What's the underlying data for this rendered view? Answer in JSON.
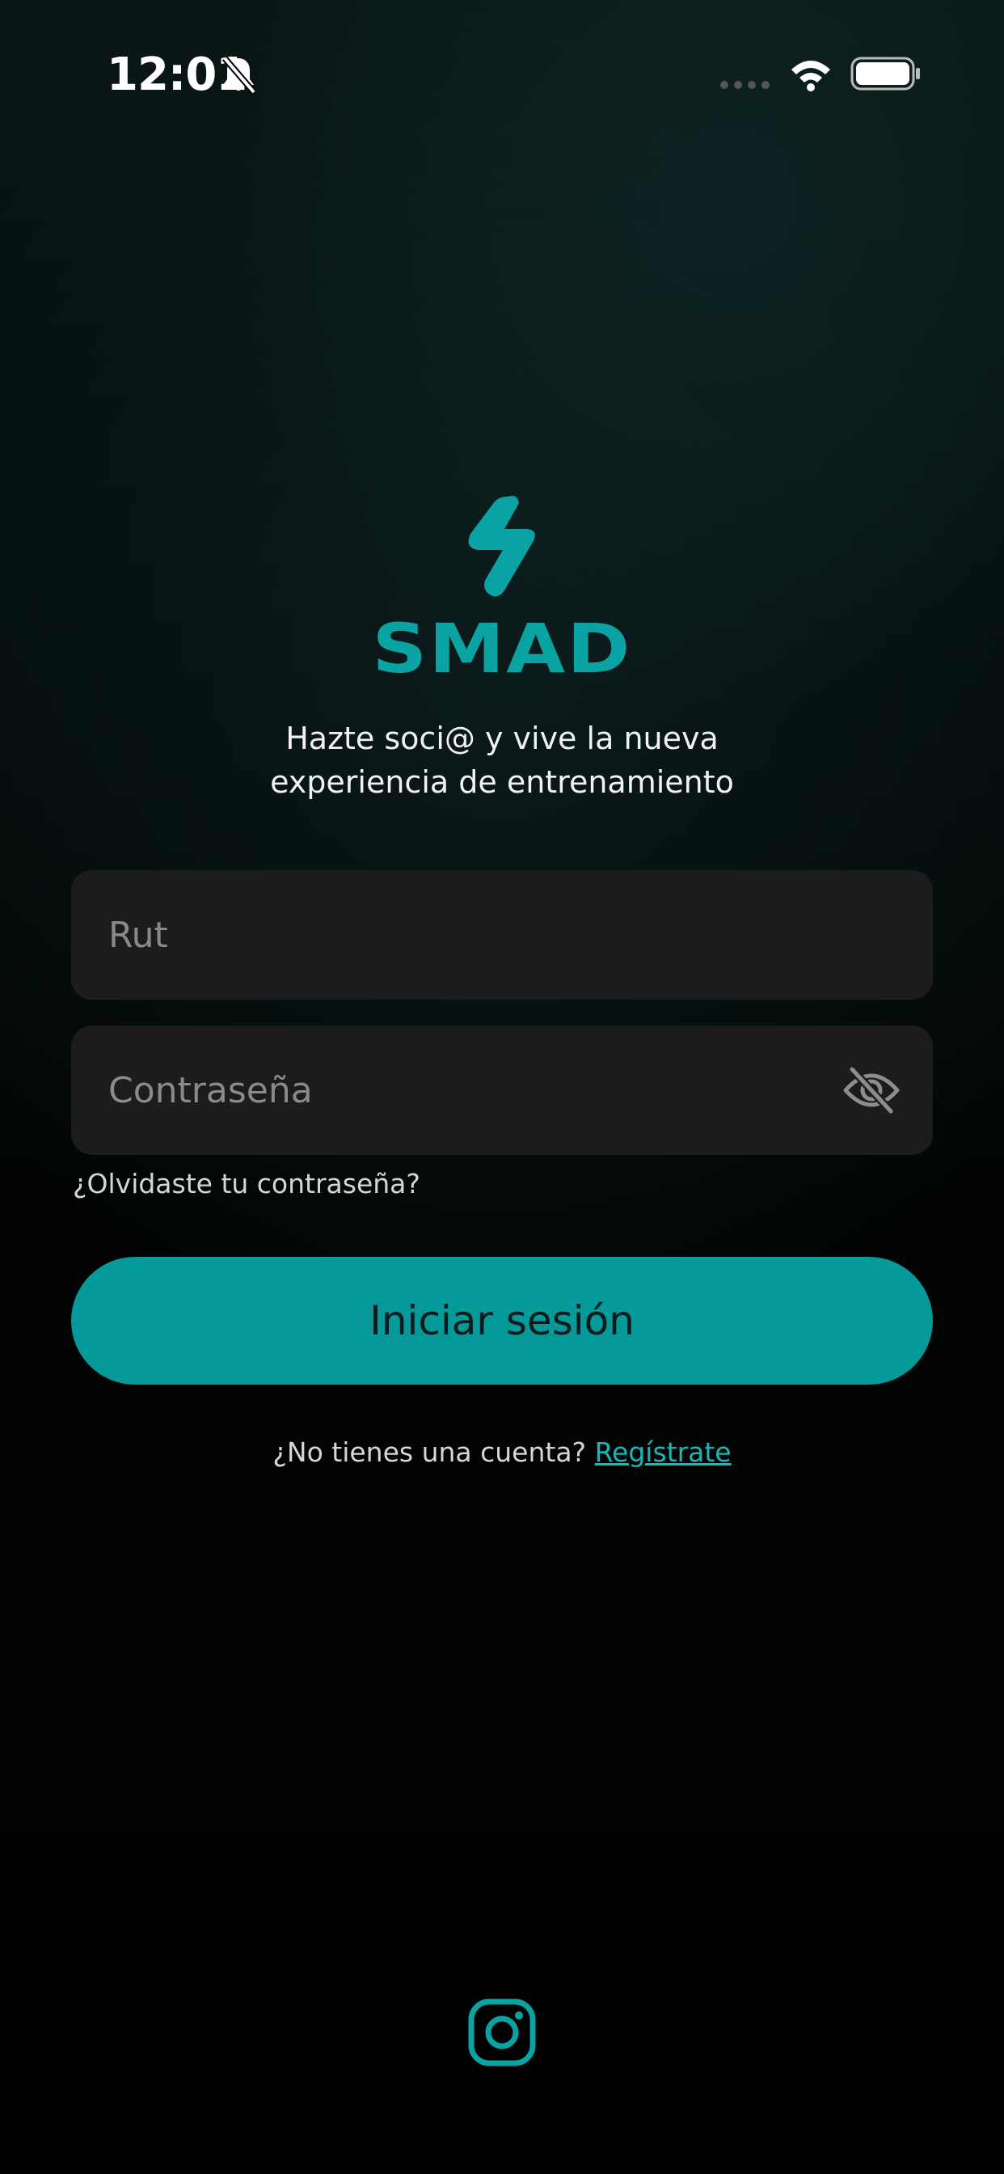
{
  "status_bar": {
    "time": "12:01",
    "icons": [
      "bell-slash-icon",
      "cellular-icon",
      "wifi-icon",
      "battery-icon"
    ]
  },
  "brand": {
    "name": "SMAD",
    "logo_icon": "lightning-bolt-icon",
    "accent_color": "#06999a"
  },
  "tagline": {
    "line1": "Hazte soci@ y vive la nueva",
    "line2": "experiencia de entrenamiento"
  },
  "form": {
    "rut_placeholder": "Rut",
    "rut_value": "",
    "password_placeholder": "Contraseña",
    "password_value": "",
    "password_toggle_icon": "eye-slash-icon",
    "forgot_password": "¿Olvidaste tu contraseña?",
    "login_button": "Iniciar sesión"
  },
  "signup": {
    "prompt": "¿No tienes una cuenta?",
    "link": "Regístrate"
  },
  "footer": {
    "social_icon": "instagram-icon"
  }
}
